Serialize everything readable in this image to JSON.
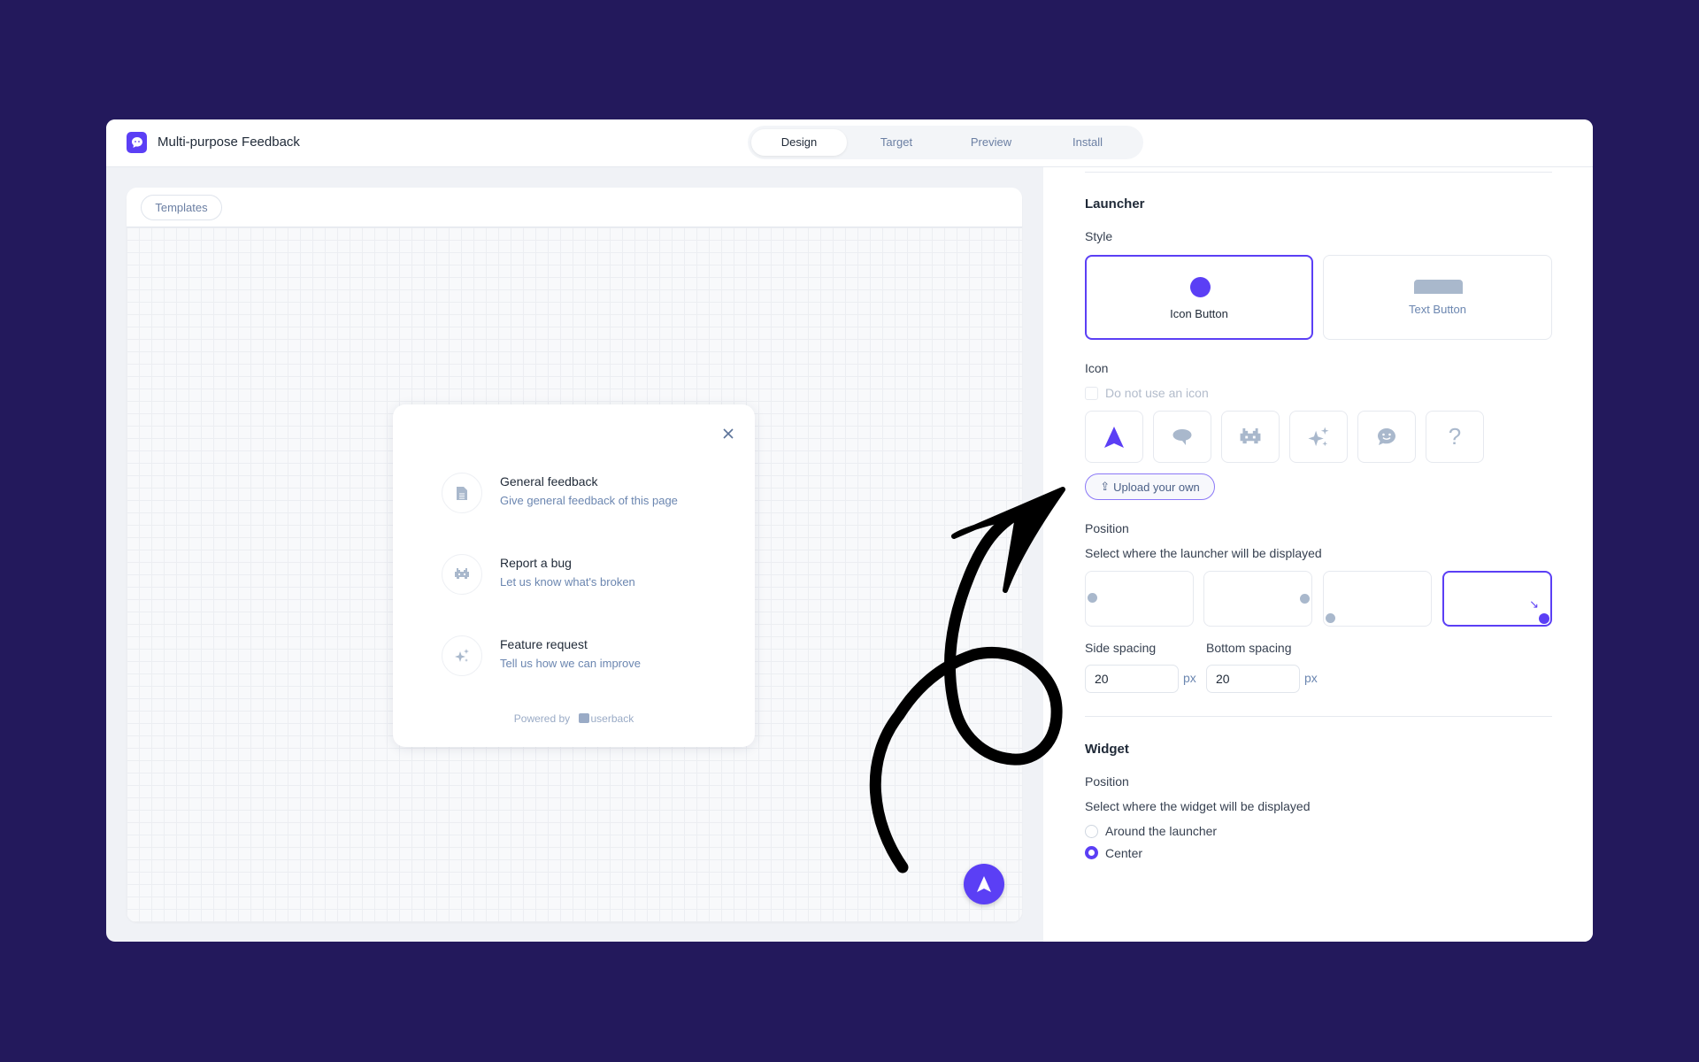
{
  "header": {
    "title": "Multi-purpose Feedback",
    "tabs": [
      {
        "label": "Design",
        "active": true
      },
      {
        "label": "Target"
      },
      {
        "label": "Preview"
      },
      {
        "label": "Install"
      }
    ]
  },
  "preview": {
    "templates_label": "Templates",
    "widget": {
      "options": [
        {
          "title": "General feedback",
          "subtitle": "Give general feedback of this page",
          "icon": "document-icon"
        },
        {
          "title": "Report a bug",
          "subtitle": "Let us know what's broken",
          "icon": "bug-icon"
        },
        {
          "title": "Feature request",
          "subtitle": "Tell us how we can improve",
          "icon": "sparkles-icon"
        }
      ],
      "powered_by": "Powered by",
      "brand": "userback"
    }
  },
  "settings": {
    "launcher": {
      "heading": "Launcher",
      "style_label": "Style",
      "styles": [
        {
          "label": "Icon Button",
          "selected": true
        },
        {
          "label": "Text Button"
        }
      ],
      "icon_label": "Icon",
      "no_icon_label": "Do not use an icon",
      "no_icon_checked": false,
      "icons": [
        "navigation-arrow-icon",
        "speech-bubble-icon",
        "bug-icon",
        "sparkles-icon",
        "smiley-chat-icon",
        "question-icon"
      ],
      "selected_icon": 0,
      "upload_label": "Upload your own",
      "position_label": "Position",
      "position_sub": "Select where the launcher will be displayed",
      "positions": [
        "left-middle",
        "right-middle",
        "bottom-left",
        "bottom-right"
      ],
      "selected_position": "bottom-right",
      "side_spacing_label": "Side spacing",
      "side_spacing": "20",
      "bottom_spacing_label": "Bottom spacing",
      "bottom_spacing": "20",
      "unit": "px"
    },
    "widget": {
      "heading": "Widget",
      "position_label": "Position",
      "position_sub": "Select where the widget will be displayed",
      "options": [
        {
          "label": "Around the launcher",
          "selected": false
        },
        {
          "label": "Center",
          "selected": true
        }
      ]
    }
  },
  "colors": {
    "accent": "#5b3ff5",
    "background": "#23195c",
    "muted": "#a9b8cc"
  }
}
